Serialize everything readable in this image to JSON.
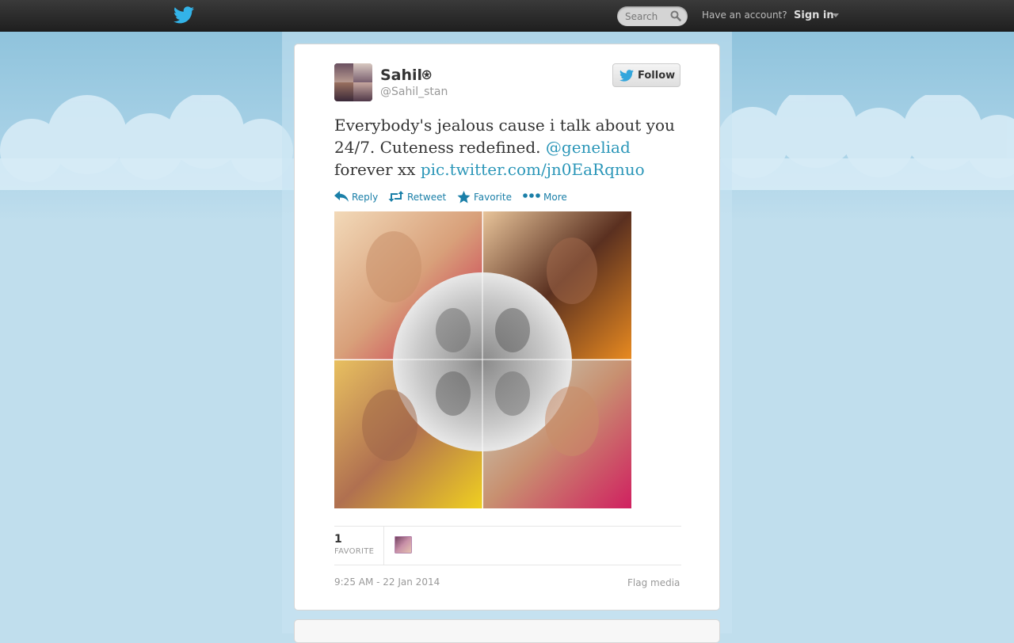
{
  "topbar": {
    "logo_icon": "twitter-bird-icon",
    "search_placeholder": "Search",
    "have_account": "Have an account?",
    "sign_in": "Sign in"
  },
  "tweet": {
    "author_name": "Sahil⍟",
    "author_handle": "@Sahil_stan",
    "follow_label": "Follow",
    "text_parts": {
      "before": "Everybody's jealous cause i talk about you 24/7. Cuteness redefined. ",
      "mention": "@geneliad",
      "middle": " forever xx ",
      "link": "pic.twitter.com/jn0EaRqnuo"
    },
    "actions": {
      "reply": "Reply",
      "retweet": "Retweet",
      "favorite": "Favorite",
      "more": "More"
    },
    "favorite_count": "1",
    "favorite_label": "FAVORITE",
    "timestamp": "9:25 AM - 22 Jan 2014",
    "flag_media": "Flag media"
  },
  "colors": {
    "link": "#2a96b8",
    "action": "#1a7fa8",
    "topbar": "#2b2b2b",
    "background": "#c0deed"
  }
}
